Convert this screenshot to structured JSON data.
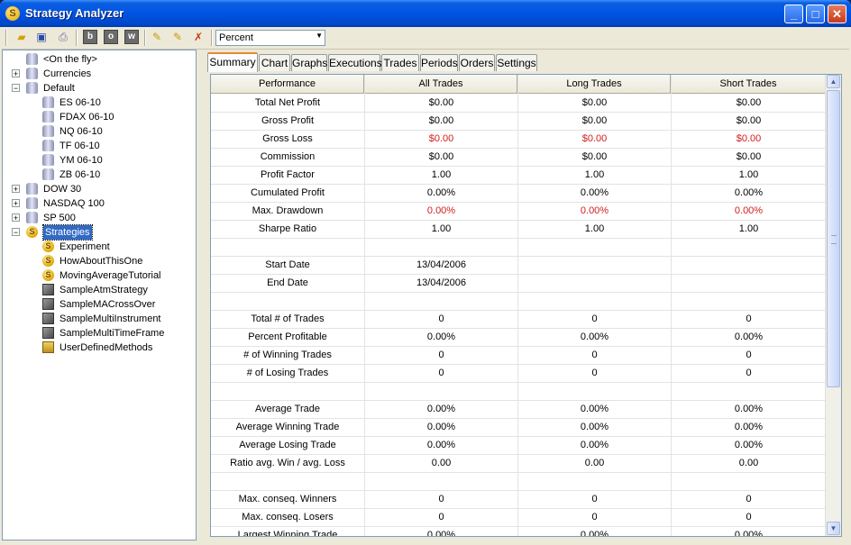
{
  "window": {
    "title": "Strategy Analyzer"
  },
  "toolbar": {
    "combo_value": "Percent"
  },
  "tree": [
    {
      "label": "<On the fly>",
      "level": 1,
      "icon": "database-icon",
      "expander": ""
    },
    {
      "label": "Currencies",
      "level": 0,
      "icon": "database-icon",
      "expander": "+"
    },
    {
      "label": "Default",
      "level": 0,
      "icon": "database-icon",
      "expander": "-"
    },
    {
      "label": "ES 06-10",
      "level": 2,
      "icon": "database-icon",
      "expander": ""
    },
    {
      "label": "FDAX 06-10",
      "level": 2,
      "icon": "database-icon",
      "expander": ""
    },
    {
      "label": "NQ 06-10",
      "level": 2,
      "icon": "database-icon",
      "expander": ""
    },
    {
      "label": "TF 06-10",
      "level": 2,
      "icon": "database-icon",
      "expander": ""
    },
    {
      "label": "YM 06-10",
      "level": 2,
      "icon": "database-icon",
      "expander": ""
    },
    {
      "label": "ZB 06-10",
      "level": 2,
      "icon": "database-icon",
      "expander": ""
    },
    {
      "label": "DOW 30",
      "level": 0,
      "icon": "database-icon",
      "expander": "+"
    },
    {
      "label": "NASDAQ 100",
      "level": 0,
      "icon": "database-icon",
      "expander": "+"
    },
    {
      "label": "SP 500",
      "level": 0,
      "icon": "database-icon",
      "expander": "+"
    },
    {
      "label": "Strategies",
      "level": 0,
      "icon": "strategy-coin-icon",
      "expander": "-",
      "selected": true
    },
    {
      "label": "Experiment",
      "level": 1,
      "icon": "strategy-coin-icon",
      "expander": ""
    },
    {
      "label": "HowAboutThisOne",
      "level": 1,
      "icon": "strategy-coin-icon",
      "expander": ""
    },
    {
      "label": "MovingAverageTutorial",
      "level": 1,
      "icon": "strategy-coin-icon",
      "expander": ""
    },
    {
      "label": "SampleAtmStrategy",
      "level": 1,
      "icon": "locked-strategy-icon",
      "expander": ""
    },
    {
      "label": "SampleMACrossOver",
      "level": 1,
      "icon": "locked-strategy-icon",
      "expander": ""
    },
    {
      "label": "SampleMultiInstrument",
      "level": 1,
      "icon": "locked-strategy-icon",
      "expander": ""
    },
    {
      "label": "SampleMultiTimeFrame",
      "level": 1,
      "icon": "locked-strategy-icon",
      "expander": ""
    },
    {
      "label": "UserDefinedMethods",
      "level": 1,
      "icon": "methods-book-icon",
      "expander": ""
    }
  ],
  "tabs": [
    "Summary",
    "Chart",
    "Graphs",
    "Executions",
    "Trades",
    "Periods",
    "Orders",
    "Settings"
  ],
  "active_tab": "Summary",
  "grid": {
    "headers": [
      "Performance",
      "All Trades",
      "Long Trades",
      "Short Trades"
    ],
    "rows": [
      {
        "label": "Total Net Profit",
        "values": [
          "$0.00",
          "$0.00",
          "$0.00"
        ]
      },
      {
        "label": "Gross Profit",
        "values": [
          "$0.00",
          "$0.00",
          "$0.00"
        ]
      },
      {
        "label": "Gross Loss",
        "values": [
          "$0.00",
          "$0.00",
          "$0.00"
        ],
        "red": true
      },
      {
        "label": "Commission",
        "values": [
          "$0.00",
          "$0.00",
          "$0.00"
        ]
      },
      {
        "label": "Profit Factor",
        "values": [
          "1.00",
          "1.00",
          "1.00"
        ]
      },
      {
        "label": "Cumulated Profit",
        "values": [
          "0.00%",
          "0.00%",
          "0.00%"
        ]
      },
      {
        "label": "Max. Drawdown",
        "values": [
          "0.00%",
          "0.00%",
          "0.00%"
        ],
        "red": true
      },
      {
        "label": "Sharpe Ratio",
        "values": [
          "1.00",
          "1.00",
          "1.00"
        ]
      },
      {
        "label": "",
        "values": [
          "",
          "",
          ""
        ]
      },
      {
        "label": "Start Date",
        "values": [
          "13/04/2006",
          "",
          ""
        ]
      },
      {
        "label": "End Date",
        "values": [
          "13/04/2006",
          "",
          ""
        ]
      },
      {
        "label": "",
        "values": [
          "",
          "",
          ""
        ]
      },
      {
        "label": "Total # of Trades",
        "values": [
          "0",
          "0",
          "0"
        ]
      },
      {
        "label": "Percent Profitable",
        "values": [
          "0.00%",
          "0.00%",
          "0.00%"
        ]
      },
      {
        "label": "# of Winning Trades",
        "values": [
          "0",
          "0",
          "0"
        ]
      },
      {
        "label": "# of Losing Trades",
        "values": [
          "0",
          "0",
          "0"
        ]
      },
      {
        "label": "",
        "values": [
          "",
          "",
          ""
        ]
      },
      {
        "label": "Average Trade",
        "values": [
          "0.00%",
          "0.00%",
          "0.00%"
        ]
      },
      {
        "label": "Average Winning Trade",
        "values": [
          "0.00%",
          "0.00%",
          "0.00%"
        ]
      },
      {
        "label": "Average Losing Trade",
        "values": [
          "0.00%",
          "0.00%",
          "0.00%"
        ]
      },
      {
        "label": "Ratio avg. Win / avg. Loss",
        "values": [
          "0.00",
          "0.00",
          "0.00"
        ]
      },
      {
        "label": "",
        "values": [
          "",
          "",
          ""
        ]
      },
      {
        "label": "Max. conseq. Winners",
        "values": [
          "0",
          "0",
          "0"
        ]
      },
      {
        "label": "Max. conseq. Losers",
        "values": [
          "0",
          "0",
          "0"
        ]
      },
      {
        "label": "Largest Winning Trade",
        "values": [
          "0.00%",
          "0.00%",
          "0.00%"
        ]
      }
    ]
  },
  "colors": {
    "title_bar": "#0054e3",
    "loss_red": "#d41c1c",
    "selection": "#316ac5",
    "active_tab_accent": "#e68b2c"
  }
}
